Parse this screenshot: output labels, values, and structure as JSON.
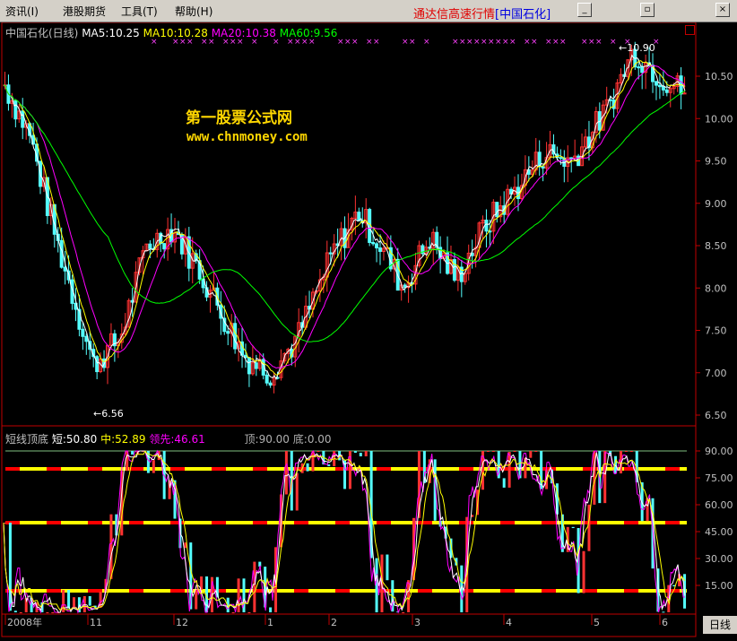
{
  "menu": {
    "items": [
      "资讯(I)",
      "港股期货",
      "工具(T)",
      "帮助(H)"
    ],
    "app_title": "通达信高速行情",
    "stock_tag": "[中国石化]"
  },
  "main_chart": {
    "title": "中国石化(日线)",
    "ma5": "MA5:10.25",
    "ma10": "MA10:10.28",
    "ma20": "MA20:10.38",
    "ma60": "MA60:9.56",
    "high_label": "10.90",
    "low_label": "6.56",
    "y_ticks": [
      "10.50",
      "10.00",
      "9.50",
      "9.00",
      "8.50",
      "8.00",
      "7.50",
      "7.00",
      "6.50"
    ],
    "y_tick_values": [
      10.5,
      10.0,
      9.5,
      9.0,
      8.5,
      8.0,
      7.5,
      7.0,
      6.5
    ],
    "colors": {
      "ma5": "#ffffff",
      "ma10": "#ffff00",
      "ma20": "#ff00ff",
      "ma60": "#00ff00",
      "up": "#ff3232",
      "down": "#54ffff"
    }
  },
  "watermark": {
    "line1": "第一股票公式网",
    "line2": "www.chnmoney.com"
  },
  "sub_chart": {
    "title": "短线顶底",
    "short": "短:50.80",
    "mid": "中:52.89",
    "lead": "领先:46.61",
    "top": "顶:90.00",
    "bottom": "底:0.00",
    "y_ticks": [
      "90.00",
      "75.00",
      "60.00",
      "45.00",
      "30.00",
      "15.00"
    ],
    "y_tick_values": [
      90,
      75,
      60,
      45,
      30,
      15
    ]
  },
  "date_axis": {
    "labels": [
      "2008年",
      "11",
      "12",
      "1",
      "2",
      "3",
      "4",
      "5",
      "6"
    ]
  },
  "period_button": "日线"
}
